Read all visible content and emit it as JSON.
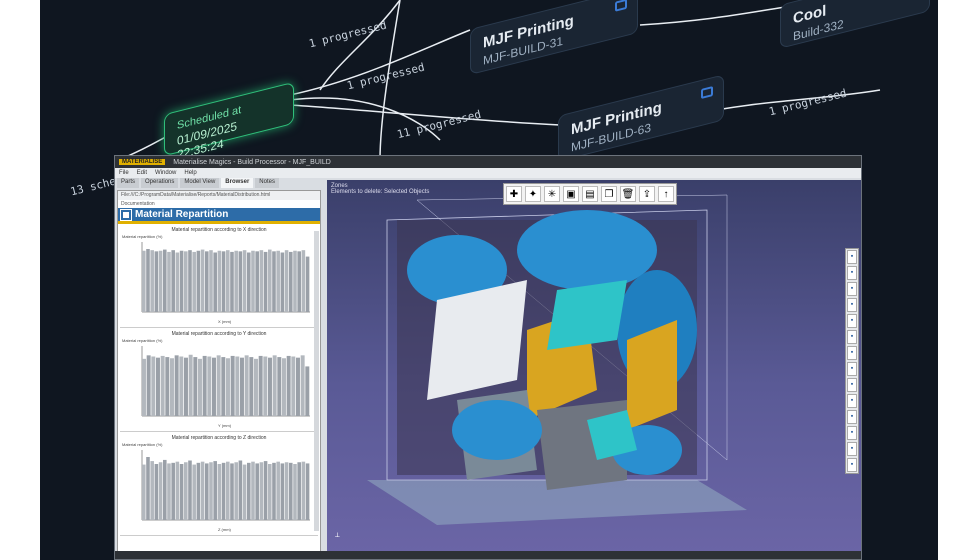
{
  "workflow": {
    "nodes": [
      {
        "title": "MJF Printing",
        "subtitle": "MJF-BUILD-31",
        "kind": "job"
      },
      {
        "title": "MJF Printing",
        "subtitle": "MJF-BUILD-63",
        "kind": "job"
      },
      {
        "title": "Cool",
        "subtitle": "Build-332",
        "kind": "job"
      },
      {
        "title": "Scheduled at",
        "subtitle": "01/09/2025 22:35:24",
        "kind": "scheduled"
      }
    ],
    "edge_labels": [
      "1 progressed",
      "1 progressed",
      "11 progressed",
      "1 progressed",
      "13 sche"
    ]
  },
  "app": {
    "brand": "MATERIALISE",
    "window_title": "Materialise Magics - Build Processor - MJF_BUILD",
    "menu": [
      "File",
      "Edit",
      "Window",
      "Help"
    ],
    "panel_tabs": [
      "Parts",
      "Operations",
      "Model View",
      "Browser",
      "Notes"
    ],
    "active_tab": "Browser",
    "path": "File:///C:/ProgramData/Materialise/Reports/MaterialDistribution.html",
    "section": "Documentation",
    "report_title": "Material Repartition",
    "viewport_info": [
      "Zones",
      "Elements to delete: Selected Objects"
    ],
    "accent": "#2d6ca8",
    "brand_color": "#e0b000",
    "toolbar_icons": [
      "cross-icon",
      "fire-icon",
      "sparkle-icon",
      "box-icon",
      "bar-icon",
      "copy-icon",
      "trash-icon",
      "export-icon",
      "arrow-up-icon"
    ],
    "right_tool_count": 14
  },
  "chart_data": [
    {
      "type": "bar",
      "title": "Material repartition according to X direction",
      "ylabel": "Material repartition (%)",
      "xlabel": "X (mm)",
      "ylim": [
        0,
        12
      ],
      "values": [
        10.5,
        10.8,
        10.6,
        10.4,
        10.5,
        10.7,
        10.3,
        10.6,
        10.2,
        10.5,
        10.4,
        10.6,
        10.3,
        10.5,
        10.7,
        10.4,
        10.6,
        10.2,
        10.5,
        10.4,
        10.6,
        10.3,
        10.5,
        10.4,
        10.6,
        10.2,
        10.5,
        10.4,
        10.6,
        10.3,
        10.7,
        10.4,
        10.5,
        10.2,
        10.6,
        10.3,
        10.5,
        10.4,
        10.6,
        9.5
      ]
    },
    {
      "type": "bar",
      "title": "Material repartition according to Y direction",
      "ylabel": "Material repartition (%)",
      "xlabel": "Y (mm)",
      "ylim": [
        0,
        12
      ],
      "values": [
        9.8,
        10.4,
        10.2,
        10.0,
        10.3,
        10.1,
        9.9,
        10.4,
        10.2,
        10.0,
        10.5,
        10.1,
        9.8,
        10.3,
        10.2,
        10.0,
        10.4,
        10.1,
        9.9,
        10.3,
        10.2,
        10.0,
        10.4,
        10.1,
        9.8,
        10.3,
        10.2,
        10.0,
        10.4,
        10.1,
        9.9,
        10.3,
        10.2,
        10.0,
        10.4,
        8.5
      ]
    },
    {
      "type": "bar",
      "title": "Material repartition according to Z direction",
      "ylabel": "Material repartition (%)",
      "xlabel": "Z (mm)",
      "ylim": [
        0,
        12
      ],
      "values": [
        9.5,
        10.8,
        10.1,
        9.6,
        9.9,
        10.3,
        9.7,
        9.8,
        10.0,
        9.6,
        9.9,
        10.2,
        9.5,
        9.8,
        10.0,
        9.7,
        9.9,
        10.1,
        9.6,
        9.8,
        10.0,
        9.7,
        9.9,
        10.2,
        9.5,
        9.8,
        10.0,
        9.7,
        9.9,
        10.1,
        9.6,
        9.8,
        10.0,
        9.7,
        9.9,
        9.8,
        9.6,
        9.9,
        10.0,
        9.7
      ]
    }
  ]
}
